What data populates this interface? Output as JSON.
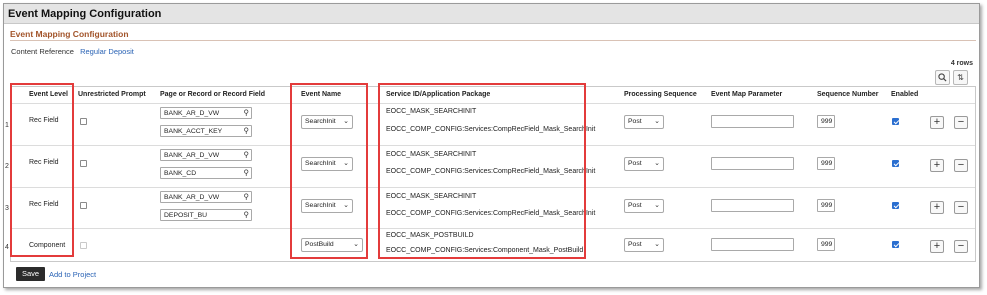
{
  "window": {
    "title": "Event Mapping Configuration"
  },
  "page": {
    "subtitle": "Event Mapping Configuration",
    "content_reference_label": "Content Reference",
    "content_reference_value": "Regular Deposit",
    "rows_count": "4 rows"
  },
  "grid": {
    "headers": {
      "event_level": "Event Level",
      "unrestricted_prompt": "Unrestricted Prompt",
      "record_field": "Page or Record or Record Field",
      "event_name": "Event Name",
      "service_id": "Service ID/Application Package",
      "processing_sequence": "Processing Sequence",
      "event_map_parameter": "Event Map Parameter",
      "sequence_number": "Sequence Number",
      "enabled": "Enabled"
    },
    "rows": [
      {
        "num": "1",
        "event_level": "Rec Field",
        "unrestricted": false,
        "record": "BANK_AR_D_VW",
        "field": "BANK_ACCT_KEY",
        "event_name": "SearchInit",
        "service_id": "EOCC_MASK_SEARCHINIT",
        "app_package": "EOCC_COMP_CONFIG:Services:CompRecField_Mask_SearchInit",
        "processing_sequence": "Post",
        "event_map_parameter": "",
        "sequence_number": "999",
        "enabled": true
      },
      {
        "num": "2",
        "event_level": "Rec Field",
        "unrestricted": false,
        "record": "BANK_AR_D_VW",
        "field": "BANK_CD",
        "event_name": "SearchInit",
        "service_id": "EOCC_MASK_SEARCHINIT",
        "app_package": "EOCC_COMP_CONFIG:Services:CompRecField_Mask_SearchInit",
        "processing_sequence": "Post",
        "event_map_parameter": "",
        "sequence_number": "999",
        "enabled": true
      },
      {
        "num": "3",
        "event_level": "Rec Field",
        "unrestricted": false,
        "record": "BANK_AR_D_VW",
        "field": "DEPOSIT_BU",
        "event_name": "SearchInit",
        "service_id": "EOCC_MASK_SEARCHINIT",
        "app_package": "EOCC_COMP_CONFIG:Services:CompRecField_Mask_SearchInit",
        "processing_sequence": "Post",
        "event_map_parameter": "",
        "sequence_number": "999",
        "enabled": true
      },
      {
        "num": "4",
        "event_level": "Component",
        "unrestricted": false,
        "record": "",
        "field": "",
        "event_name": "PostBuild",
        "service_id": "EOCC_MASK_POSTBUILD",
        "app_package": "EOCC_COMP_CONFIG:Services:Component_Mask_PostBuild",
        "processing_sequence": "Post",
        "event_map_parameter": "",
        "sequence_number": "999",
        "enabled": true
      }
    ]
  },
  "footer": {
    "save_label": "Save",
    "add_to_project_label": "Add to Project"
  },
  "icons": {
    "search": "search-icon",
    "sort": "sort-icon",
    "lookup": "lookup-icon",
    "dropdown": "chevron-down-icon",
    "add": "plus-icon",
    "delete": "minus-icon"
  },
  "colors": {
    "accent_title": "#a2542a",
    "link": "#2a63b5",
    "highlight_box": "#e33b3b",
    "save_button": "#2b2b2b"
  }
}
